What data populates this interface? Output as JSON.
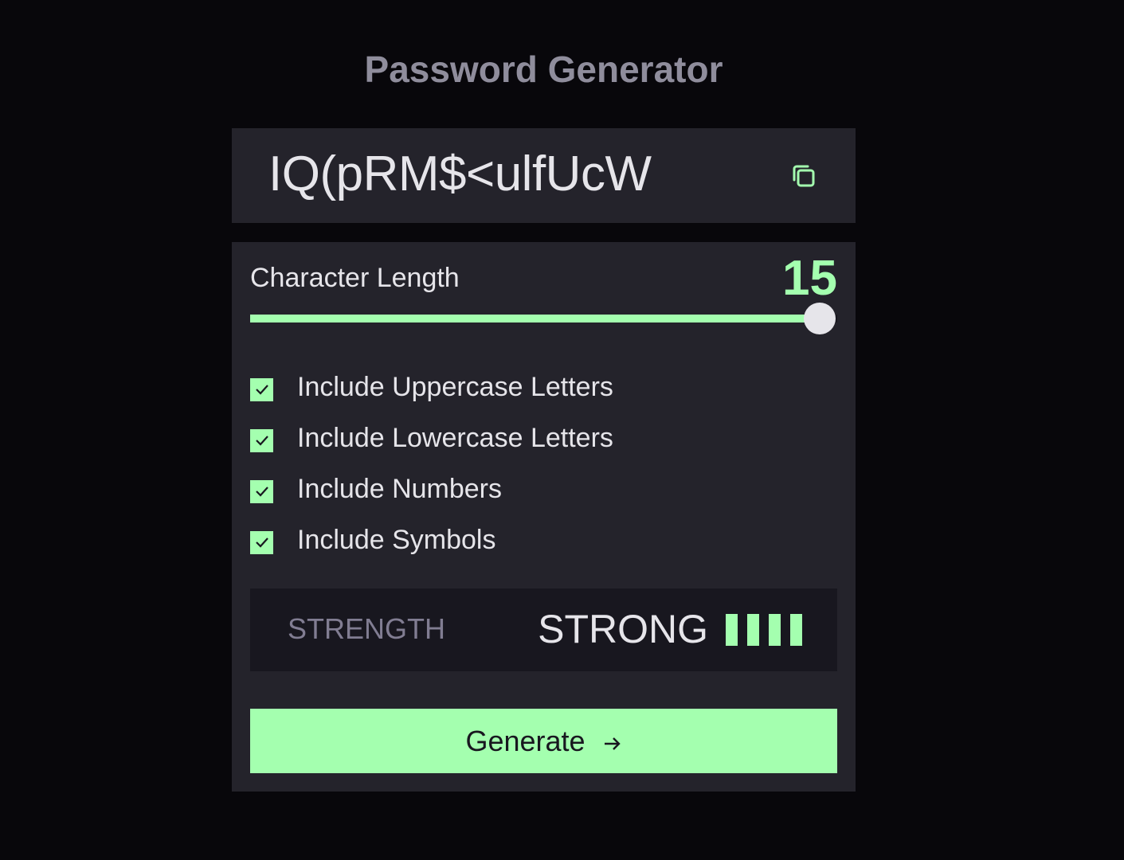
{
  "app": {
    "title": "Password Generator"
  },
  "output": {
    "password": "IQ(pRM$<ulfUcW",
    "copy_icon": "copy-icon"
  },
  "length": {
    "label": "Character Length",
    "value": "15",
    "fill_fraction": 0.97
  },
  "options": [
    {
      "label": "Include Uppercase Letters",
      "checked": true
    },
    {
      "label": "Include Lowercase Letters",
      "checked": true
    },
    {
      "label": "Include Numbers",
      "checked": true
    },
    {
      "label": "Include Symbols",
      "checked": true
    }
  ],
  "strength": {
    "label": "STRENGTH",
    "value": "STRONG",
    "bars_filled": 4,
    "bars_total": 4
  },
  "generate": {
    "label": "Generate",
    "icon": "arrow-right-icon"
  },
  "colors": {
    "accent": "#a4ffaf",
    "panel": "#24232b",
    "background": "#08070b",
    "text": "#e6e5ea",
    "muted": "#817d92"
  }
}
